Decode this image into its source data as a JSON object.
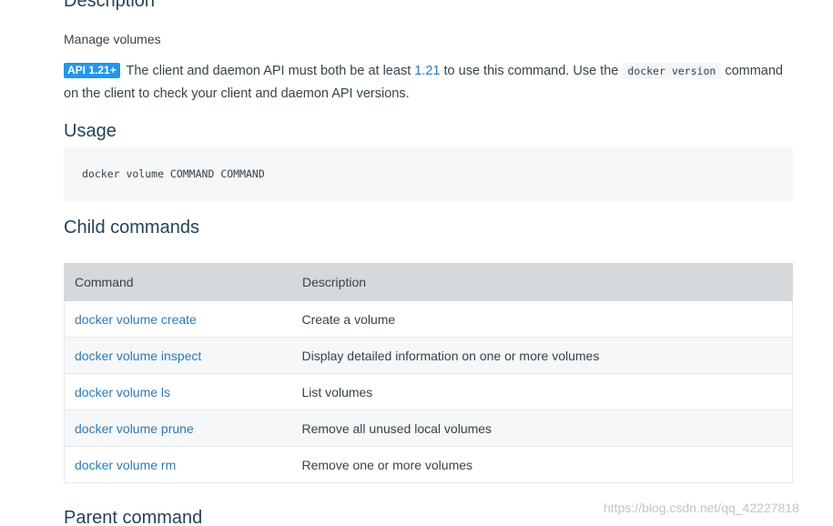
{
  "sections": {
    "description_heading": "Description",
    "usage_heading": "Usage",
    "child_heading": "Child commands",
    "parent_heading": "Parent command"
  },
  "description": {
    "text": "Manage volumes",
    "api_badge": "API 1.21+",
    "api_text_1": " The client and daemon API must both be at least ",
    "api_version_link": "1.21",
    "api_text_2": " to use this command. Use the ",
    "api_code": "docker version",
    "api_text_3": " command on the client to check your client and daemon API versions."
  },
  "usage": {
    "code": "docker volume COMMAND COMMAND"
  },
  "child_table": {
    "headers": [
      "Command",
      "Description"
    ],
    "rows": [
      {
        "command": "docker volume create",
        "description": "Create a volume"
      },
      {
        "command": "docker volume inspect",
        "description": "Display detailed information on one or more volumes"
      },
      {
        "command": "docker volume ls",
        "description": "List volumes"
      },
      {
        "command": "docker volume prune",
        "description": "Remove all unused local volumes"
      },
      {
        "command": "docker volume rm",
        "description": "Remove one or more volumes"
      }
    ]
  },
  "watermark": "https://blog.csdn.net/qq_42227818",
  "colors": {
    "badge": "#2496ed",
    "link": "#2a7ab8",
    "heading": "#254356",
    "table_header": "#d5d9dc"
  }
}
